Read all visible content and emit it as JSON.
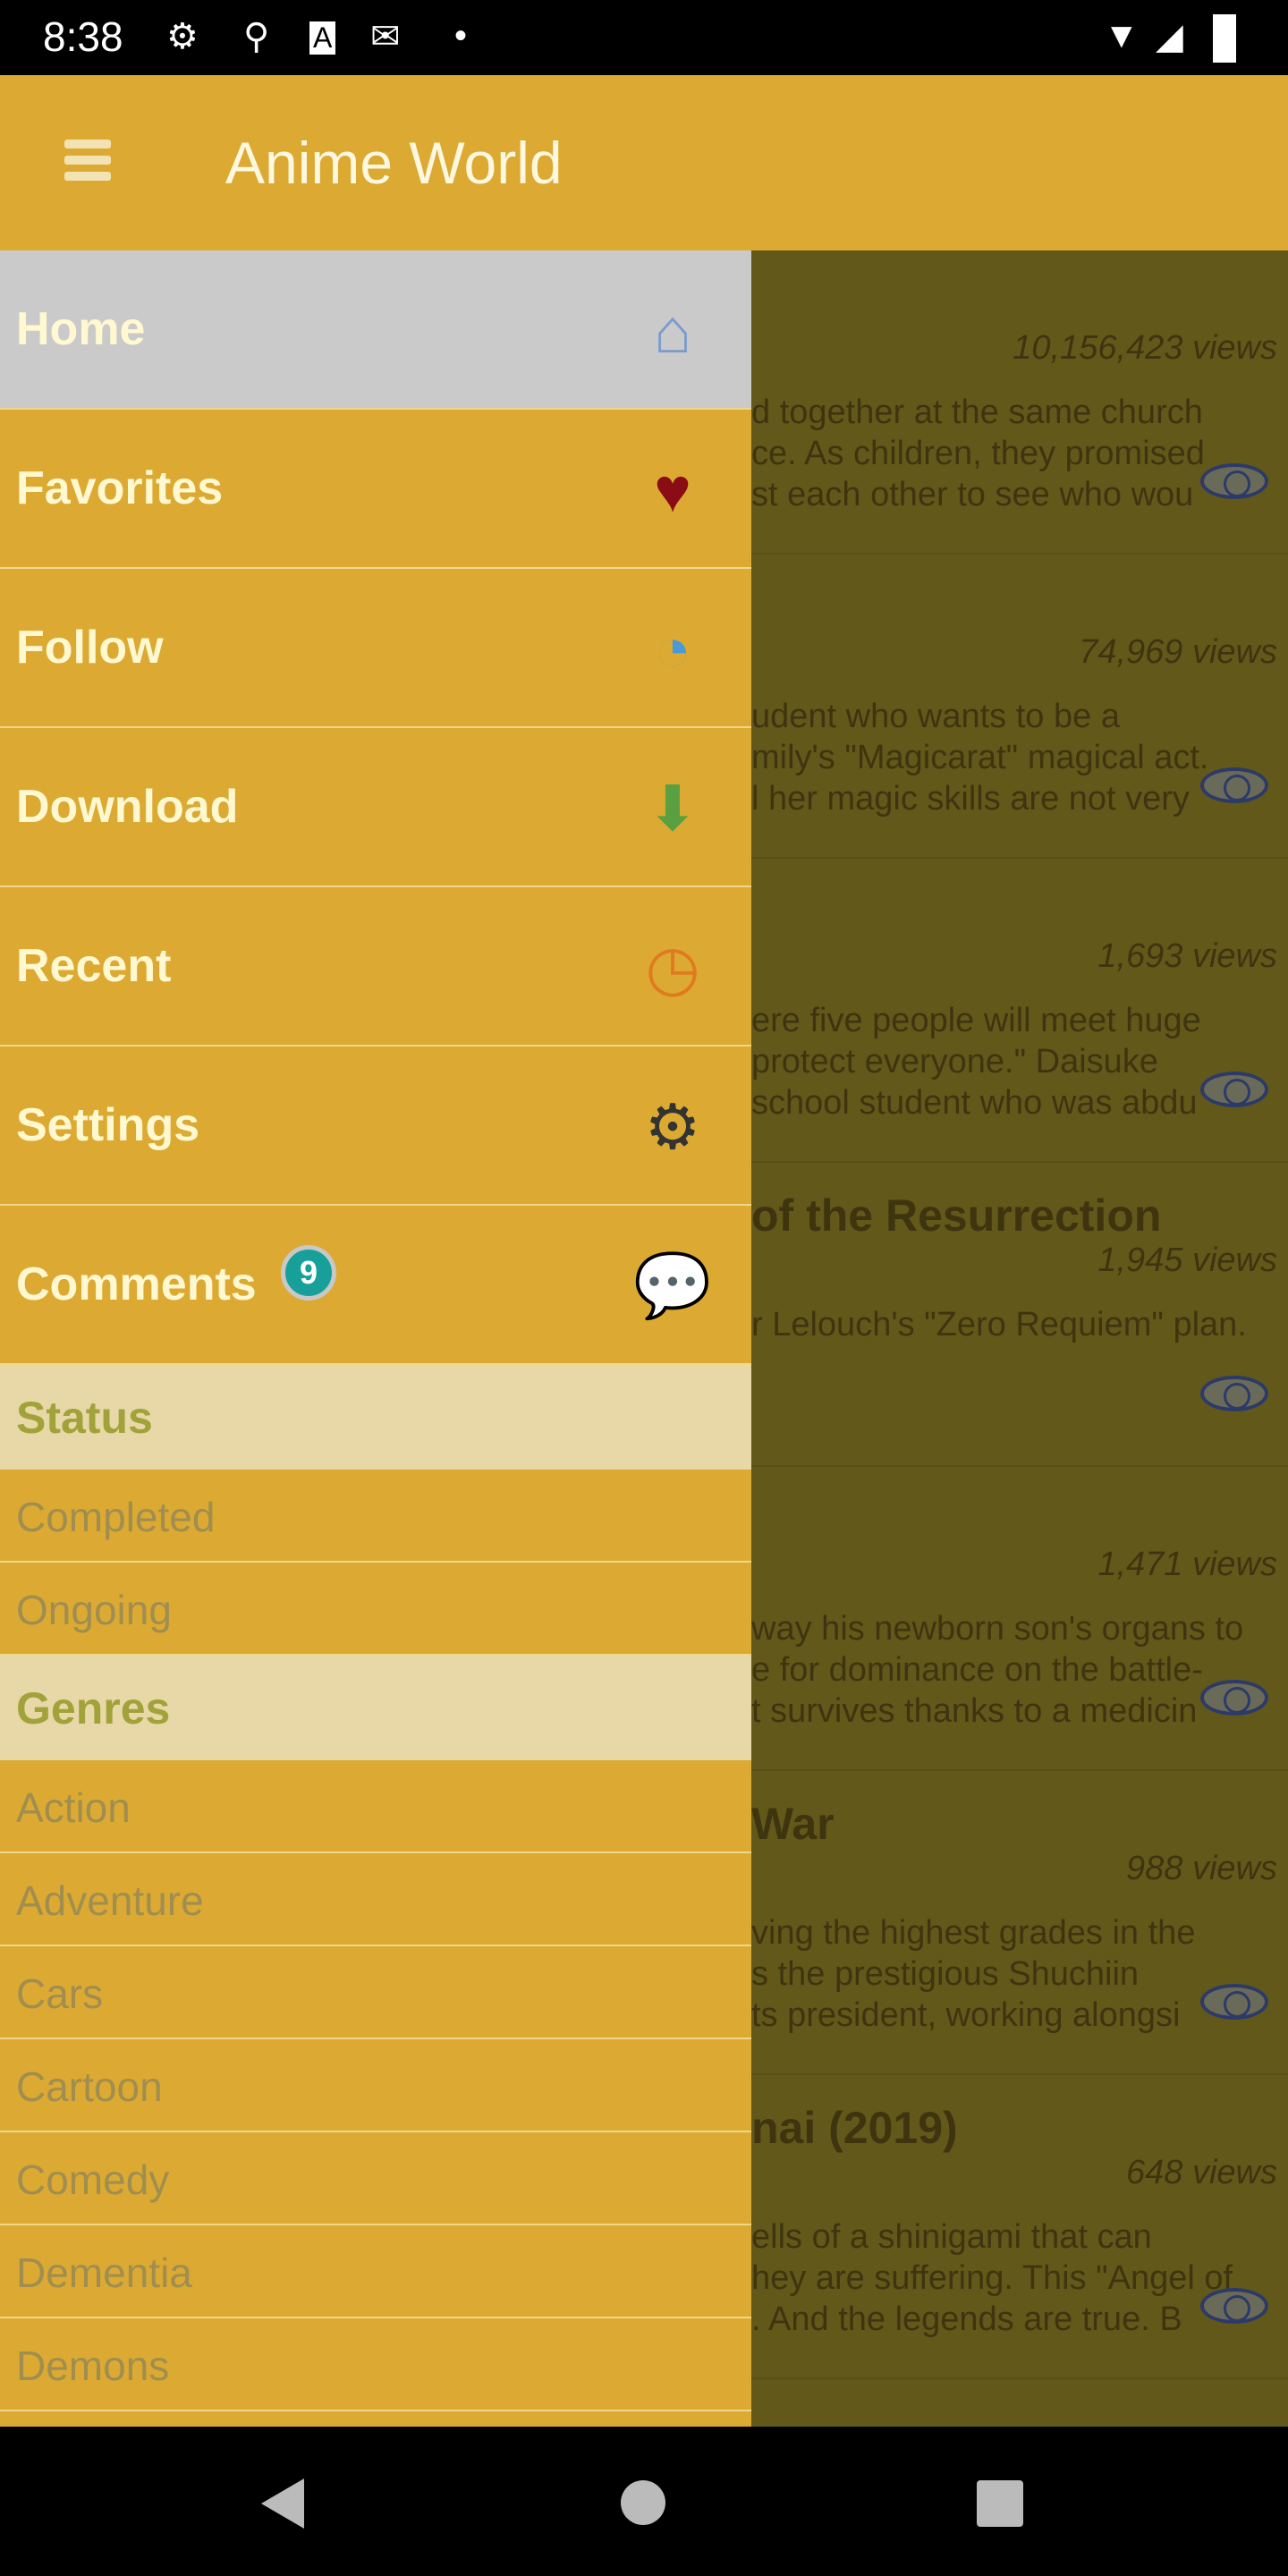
{
  "status_bar": {
    "time": "8:38",
    "icons": [
      "gear-icon",
      "keyhole-icon",
      "a-icon",
      "gmail-icon",
      "dot-icon",
      "wifi-icon",
      "signal-icon",
      "battery-charging-icon"
    ]
  },
  "app_bar": {
    "title": "Anime World",
    "menu_icon": "hamburger-icon"
  },
  "drawer": {
    "items": [
      {
        "label": "Home",
        "icon": "home-icon",
        "active": true
      },
      {
        "label": "Favorites",
        "icon": "heart-icon"
      },
      {
        "label": "Follow",
        "icon": "rss-icon"
      },
      {
        "label": "Download",
        "icon": "download-icon"
      },
      {
        "label": "Recent",
        "icon": "clock-icon"
      },
      {
        "label": "Settings",
        "icon": "gear-icon"
      },
      {
        "label": "Comments",
        "icon": "chat-icon",
        "badge": "9"
      }
    ],
    "status": {
      "header": "Status",
      "items": [
        "Completed",
        "Ongoing"
      ]
    },
    "genres": {
      "header": "Genres",
      "items": [
        "Action",
        "Adventure",
        "Cars",
        "Cartoon",
        "Comedy",
        "Dementia",
        "Demons"
      ]
    }
  },
  "content": {
    "cards": [
      {
        "title": "",
        "views": "10,156,423 views",
        "desc": "d together at the same church\nce. As children, they promised\nst each other to see who wou"
      },
      {
        "title": "",
        "views": "74,969 views",
        "desc": "udent who wants to be a\nmily's \"Magicarat\" magical act.\nl her magic skills are not very"
      },
      {
        "title": "",
        "views": "1,693 views",
        "desc": "ere five people will meet huge\nprotect everyone.\" Daisuke\nschool student who was abdu"
      },
      {
        "title": "of the Resurrection",
        "views": "1,945 views",
        "desc": "r Lelouch's \"Zero Requiem\" plan."
      },
      {
        "title": "",
        "views": "1,471 views",
        "desc": "way his newborn son's organs to\ne for dominance on the battle-\nt survives thanks to a medicin"
      },
      {
        "title": "War",
        "views": "988 views",
        "desc": "ving the highest grades in the\ns the prestigious Shuchiin\nts president, working alongsi"
      },
      {
        "title": "nai (2019)",
        "views": "648 views",
        "desc": "ells of a shinigami that can\nhey are suffering. This \"Angel of\n. And the legends are true. B"
      }
    ]
  },
  "colors": {
    "drawer": "#dcaa32",
    "overlay": "#62581a",
    "section_header": "#e8d8a8",
    "active": "#cbcacb",
    "badge": "#17a09a"
  }
}
